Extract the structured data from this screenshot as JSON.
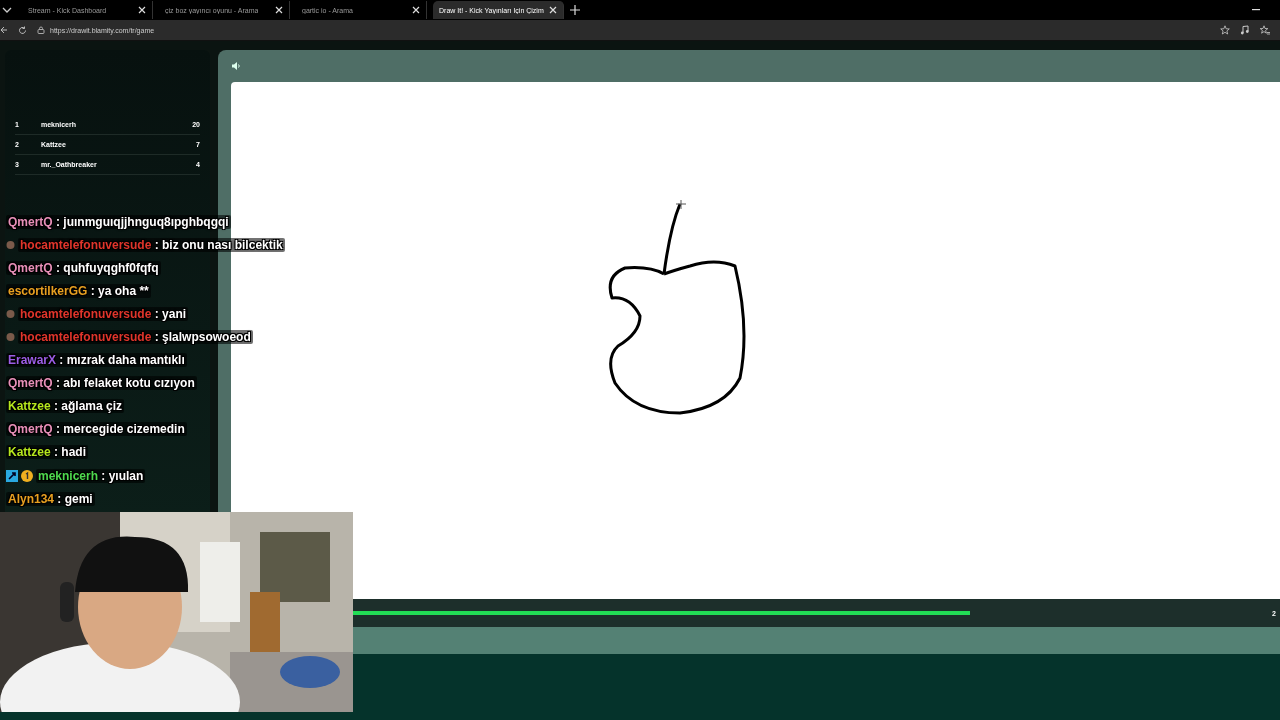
{
  "tabs": [
    {
      "title": "Stream - Kick Dashboard",
      "selected": false
    },
    {
      "title": "çiz boz yayıncı oyunu - Arama",
      "selected": false
    },
    {
      "title": "gartic io - Arama",
      "selected": false
    },
    {
      "title": "Draw It! - Kick Yayınları İçin Çizim",
      "selected": true
    }
  ],
  "address": {
    "url": "https://drawit.blamity.com/tr/game"
  },
  "leaderboard": [
    {
      "rank": "1",
      "name": "meknicerh",
      "score": "20"
    },
    {
      "rank": "2",
      "name": "Kattzee",
      "score": "7"
    },
    {
      "rank": "3",
      "name": "mr._Oathbreaker",
      "score": "4"
    }
  ],
  "timer": {
    "level": 0.71,
    "reading": "2"
  },
  "chat": [
    {
      "user": "QmertQ",
      "color": "#e88fb8",
      "text": ": juınmguıqjjhnguq8ıpghbqgqi",
      "kind": "plain"
    },
    {
      "user": "hocamtelefonuversude",
      "color": "#e0352b",
      "text": ": biz onu nası bilcektik",
      "kind": "badge"
    },
    {
      "user": "QmertQ",
      "color": "#e88fb8",
      "text": ": quhfuyqghf0fqfq",
      "kind": "plain"
    },
    {
      "user": "escortilkerGG",
      "color": "#e8a020",
      "text": ": ya oha **",
      "kind": "plain"
    },
    {
      "user": "hocamtelefonuversude",
      "color": "#e0352b",
      "text": ": yani",
      "kind": "badge"
    },
    {
      "user": "hocamtelefonuversude",
      "color": "#e0352b",
      "text": ": şlalwpsowoeod",
      "kind": "badge"
    },
    {
      "user": "ErawarX",
      "color": "#9b5de5",
      "text": ": mızrak daha mantıklı",
      "kind": "plain"
    },
    {
      "user": "QmertQ",
      "color": "#e88fb8",
      "text": ": abı felaket kotu cızıyon",
      "kind": "plain"
    },
    {
      "user": "Kattzee",
      "color": "#b5e61d",
      "text": ": ağlama çiz",
      "kind": "plain"
    },
    {
      "user": "QmertQ",
      "color": "#e88fb8",
      "text": ": mercegide cizemedin",
      "kind": "plain"
    },
    {
      "user": "Kattzee",
      "color": "#b5e61d",
      "text": ": hadi",
      "kind": "plain"
    },
    {
      "user": "meknicerh",
      "color": "#4ed94e",
      "text": ": yıulan",
      "kind": "vip"
    },
    {
      "user": "Alyn134",
      "color": "#e8a020",
      "text": ": gemi",
      "kind": "plain"
    }
  ]
}
